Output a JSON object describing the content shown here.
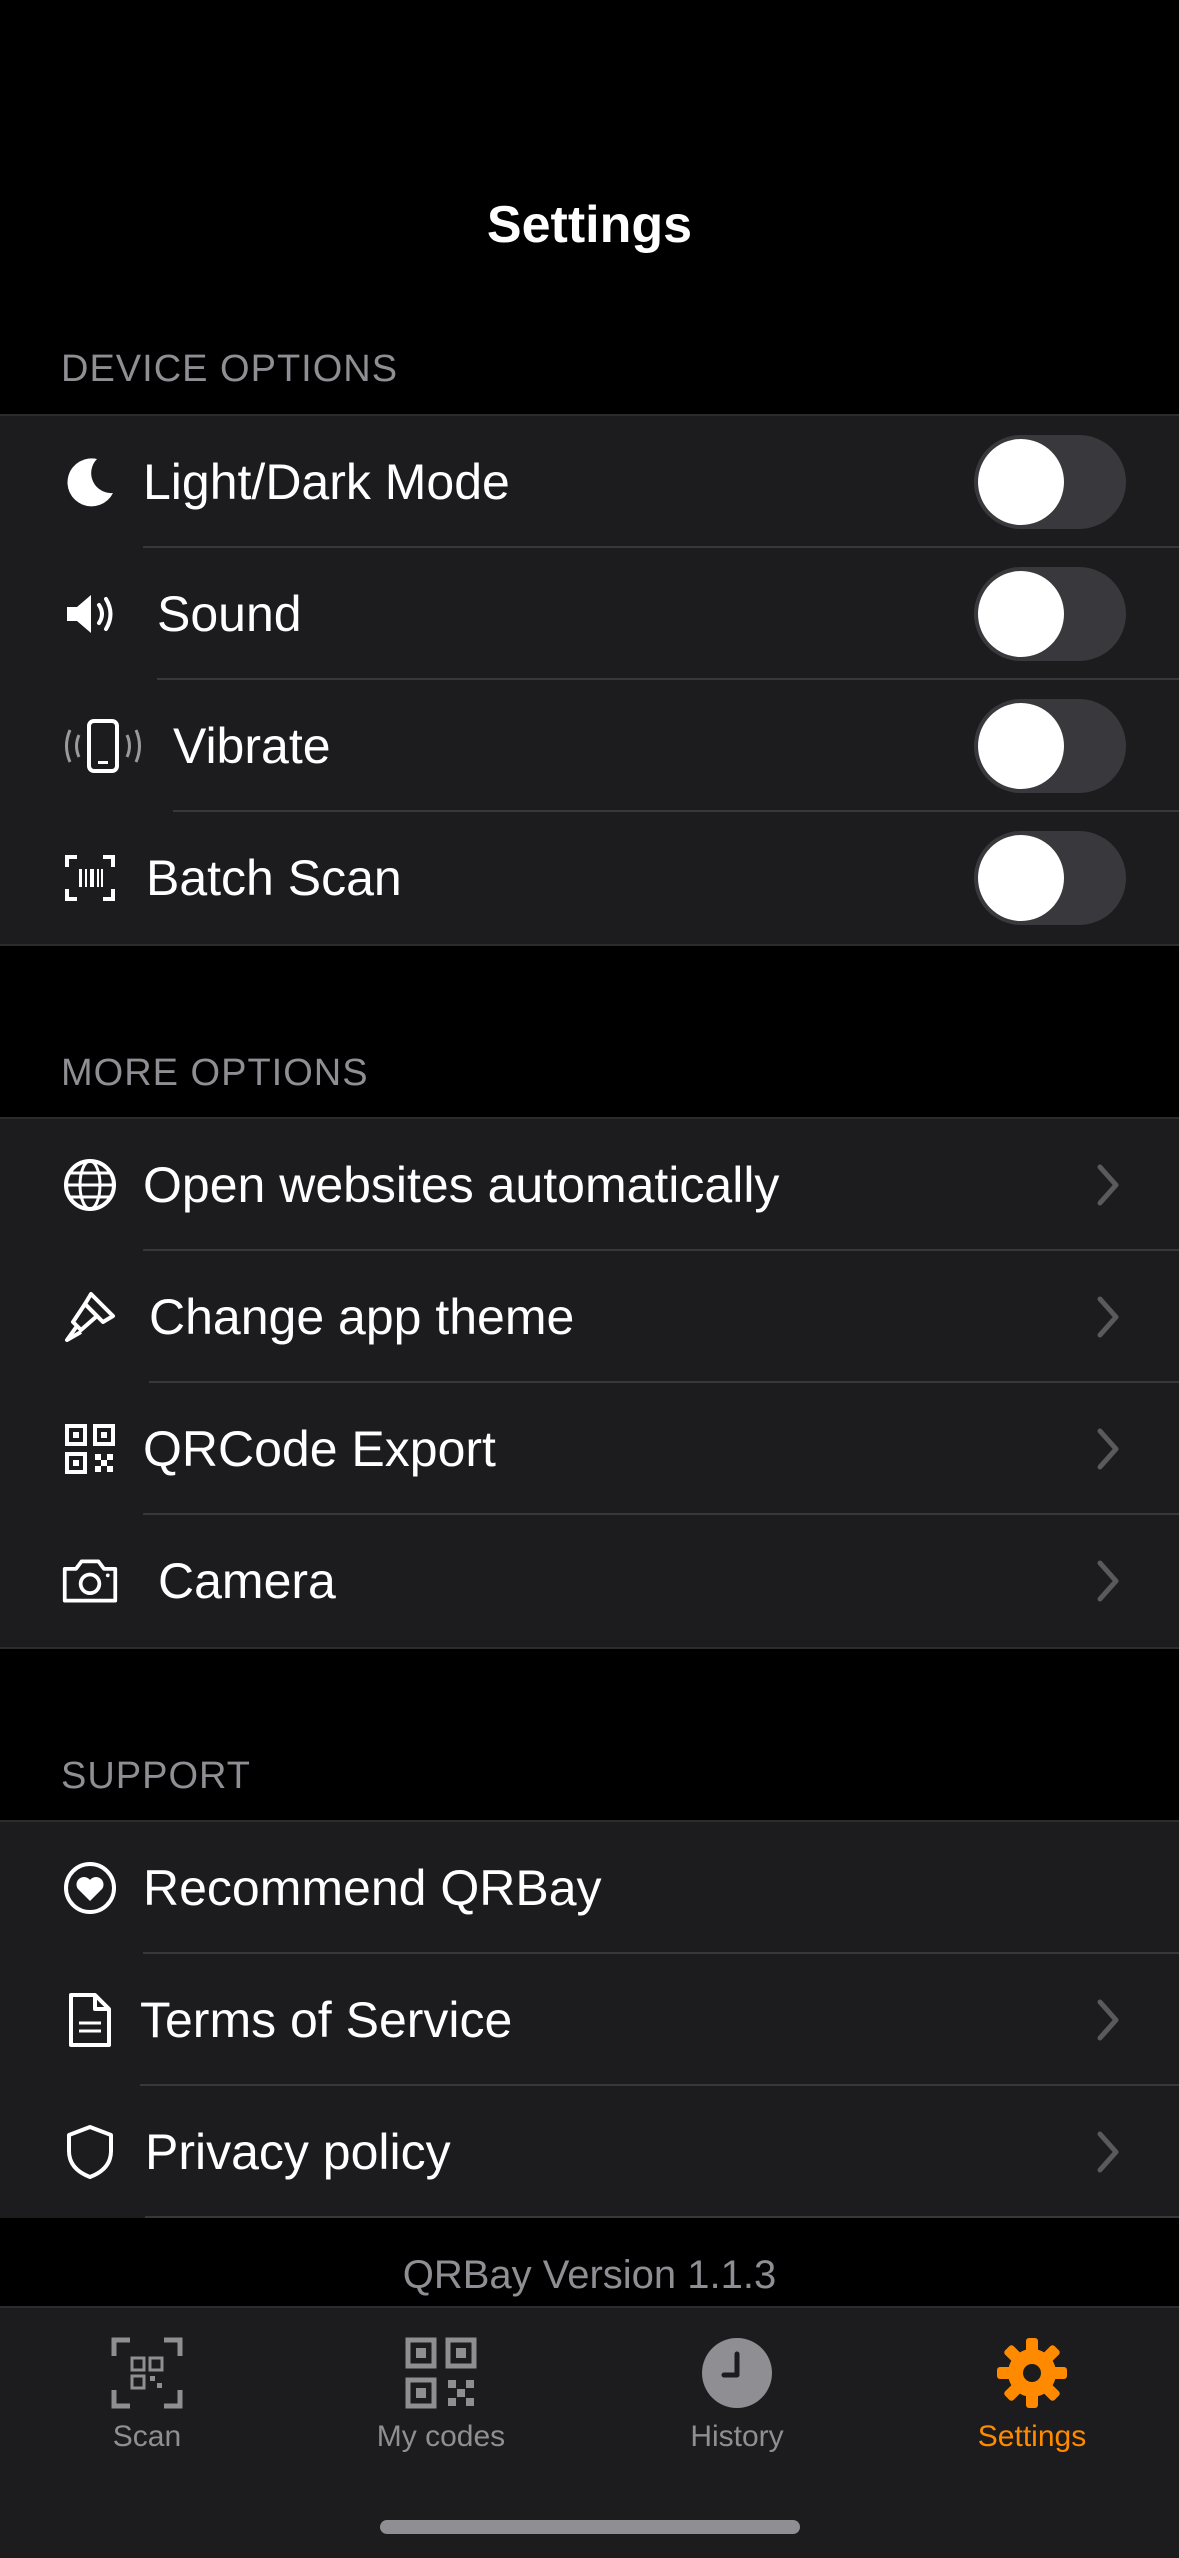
{
  "header": {
    "title": "Settings"
  },
  "sections": {
    "device": {
      "title": "DEVICE OPTIONS",
      "items": [
        {
          "label": "Light/Dark Mode",
          "icon": "moon-icon",
          "toggle_on": false
        },
        {
          "label": "Sound",
          "icon": "speaker-icon",
          "toggle_on": false
        },
        {
          "label": "Vibrate",
          "icon": "phone-vibrate-icon",
          "toggle_on": false
        },
        {
          "label": "Batch Scan",
          "icon": "barcode-scan-icon",
          "toggle_on": false
        }
      ]
    },
    "more": {
      "title": "MORE OPTIONS",
      "items": [
        {
          "label": "Open websites automatically",
          "icon": "globe-icon"
        },
        {
          "label": "Change app theme",
          "icon": "paintbrush-icon"
        },
        {
          "label": "QRCode Export",
          "icon": "qrcode-icon"
        },
        {
          "label": "Camera",
          "icon": "camera-icon"
        }
      ]
    },
    "support": {
      "title": "SUPPORT",
      "items": [
        {
          "label": "Recommend QRBay",
          "icon": "heart-circle-icon"
        },
        {
          "label": "Terms of Service",
          "icon": "document-icon"
        },
        {
          "label": "Privacy policy",
          "icon": "shield-icon"
        }
      ]
    }
  },
  "version": "QRBay Version 1.1.3",
  "tabbar": {
    "tabs": [
      {
        "label": "Scan",
        "icon": "qr-scan-icon",
        "active": false
      },
      {
        "label": "My codes",
        "icon": "qrcode-icon",
        "active": false
      },
      {
        "label": "History",
        "icon": "clock-icon",
        "active": false
      },
      {
        "label": "Settings",
        "icon": "gear-icon",
        "active": true
      }
    ]
  },
  "colors": {
    "accent": "#ff8a00",
    "background": "#000000",
    "group_background": "#1c1c1e",
    "secondary_text": "#8e8e93",
    "toggle_off": "#39393d"
  }
}
